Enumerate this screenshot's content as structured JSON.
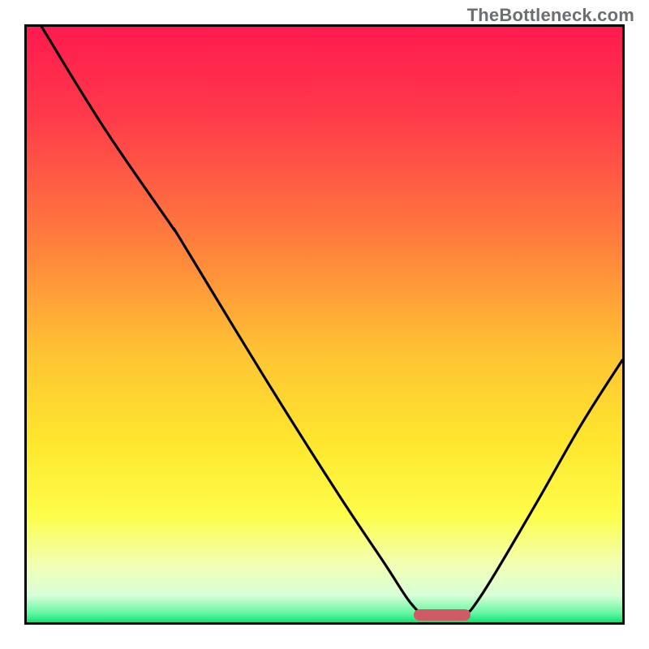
{
  "watermark": "TheBottleneck.com",
  "colors": {
    "frame": "#000000",
    "curve": "#000000",
    "marker": "#d05a68",
    "gradient_stops": [
      {
        "offset": 0.0,
        "color": "#ff1a4f"
      },
      {
        "offset": 0.15,
        "color": "#ff3a4a"
      },
      {
        "offset": 0.35,
        "color": "#ff7a3e"
      },
      {
        "offset": 0.55,
        "color": "#ffc433"
      },
      {
        "offset": 0.7,
        "color": "#ffe72e"
      },
      {
        "offset": 0.82,
        "color": "#fdfd4a"
      },
      {
        "offset": 0.9,
        "color": "#f3ffb0"
      },
      {
        "offset": 0.955,
        "color": "#d8ffd8"
      },
      {
        "offset": 0.985,
        "color": "#62f7a0"
      },
      {
        "offset": 1.0,
        "color": "#12e079"
      }
    ]
  },
  "chart_data": {
    "type": "line",
    "title": "",
    "xlabel": "",
    "ylabel": "",
    "xlim": [
      0,
      100
    ],
    "ylim": [
      0,
      100
    ],
    "grid": false,
    "legend": false,
    "curve_points": [
      {
        "x": 2.5,
        "y": 100
      },
      {
        "x": 13,
        "y": 83
      },
      {
        "x": 24,
        "y": 67
      },
      {
        "x": 26,
        "y": 64
      },
      {
        "x": 40,
        "y": 41
      },
      {
        "x": 52,
        "y": 22
      },
      {
        "x": 60,
        "y": 10
      },
      {
        "x": 64.5,
        "y": 3.2
      },
      {
        "x": 67,
        "y": 1.6
      },
      {
        "x": 73,
        "y": 1.6
      },
      {
        "x": 76,
        "y": 4.0
      },
      {
        "x": 85,
        "y": 19
      },
      {
        "x": 93,
        "y": 33
      },
      {
        "x": 100,
        "y": 44
      }
    ],
    "marker_segment": {
      "x1": 65,
      "x2": 74.5,
      "y": 1.2
    }
  }
}
